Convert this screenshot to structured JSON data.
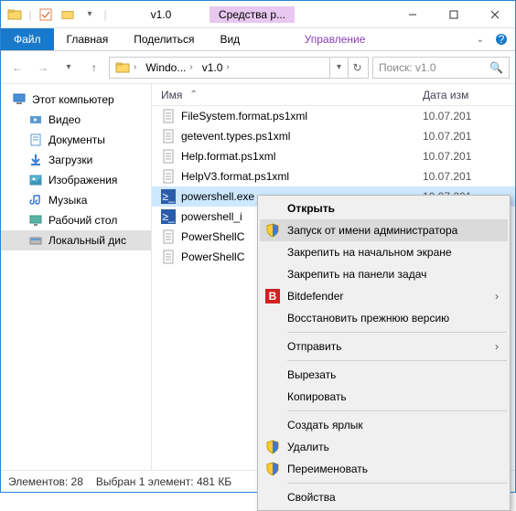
{
  "title": "v1.0",
  "title_contextual": "Средства р...",
  "ribbon": {
    "file": "Файл",
    "home": "Главная",
    "share": "Поделиться",
    "view": "Вид",
    "manage": "Управление"
  },
  "breadcrumb": {
    "items": [
      "Windo...",
      "v1.0"
    ]
  },
  "search": {
    "placeholder": "Поиск: v1.0"
  },
  "tree": {
    "root": "Этот компьютер",
    "items": [
      "Видео",
      "Документы",
      "Загрузки",
      "Изображения",
      "Музыка",
      "Рабочий стол",
      "Локальный дис"
    ]
  },
  "columns": {
    "name": "Имя",
    "date": "Дата изм"
  },
  "files": [
    {
      "name": "FileSystem.format.ps1xml",
      "date": "10.07.201",
      "icon": "file"
    },
    {
      "name": "getevent.types.ps1xml",
      "date": "10.07.201",
      "icon": "file"
    },
    {
      "name": "Help.format.ps1xml",
      "date": "10.07.201",
      "icon": "file"
    },
    {
      "name": "HelpV3.format.ps1xml",
      "date": "10.07.201",
      "icon": "file"
    },
    {
      "name": "powershell.exe",
      "date": "10.07.201",
      "icon": "ps",
      "selected": true
    },
    {
      "name": "powershell_i",
      "date": "",
      "icon": "ps"
    },
    {
      "name": "PowerShellC",
      "date": "",
      "icon": "file"
    },
    {
      "name": "PowerShellC",
      "date": "",
      "icon": "file"
    }
  ],
  "status": {
    "count": "Элементов: 28",
    "selection": "Выбран 1 элемент: 481 КБ"
  },
  "ctx": {
    "open": "Открыть",
    "runadmin": "Запуск от имени администратора",
    "pinstart": "Закрепить на начальном экране",
    "pintask": "Закрепить на панели задач",
    "bitdefender": "Bitdefender",
    "restore": "Восстановить прежнюю версию",
    "sendto": "Отправить",
    "cut": "Вырезать",
    "copy": "Копировать",
    "shortcut": "Создать ярлык",
    "delete": "Удалить",
    "rename": "Переименовать",
    "properties": "Свойства"
  }
}
